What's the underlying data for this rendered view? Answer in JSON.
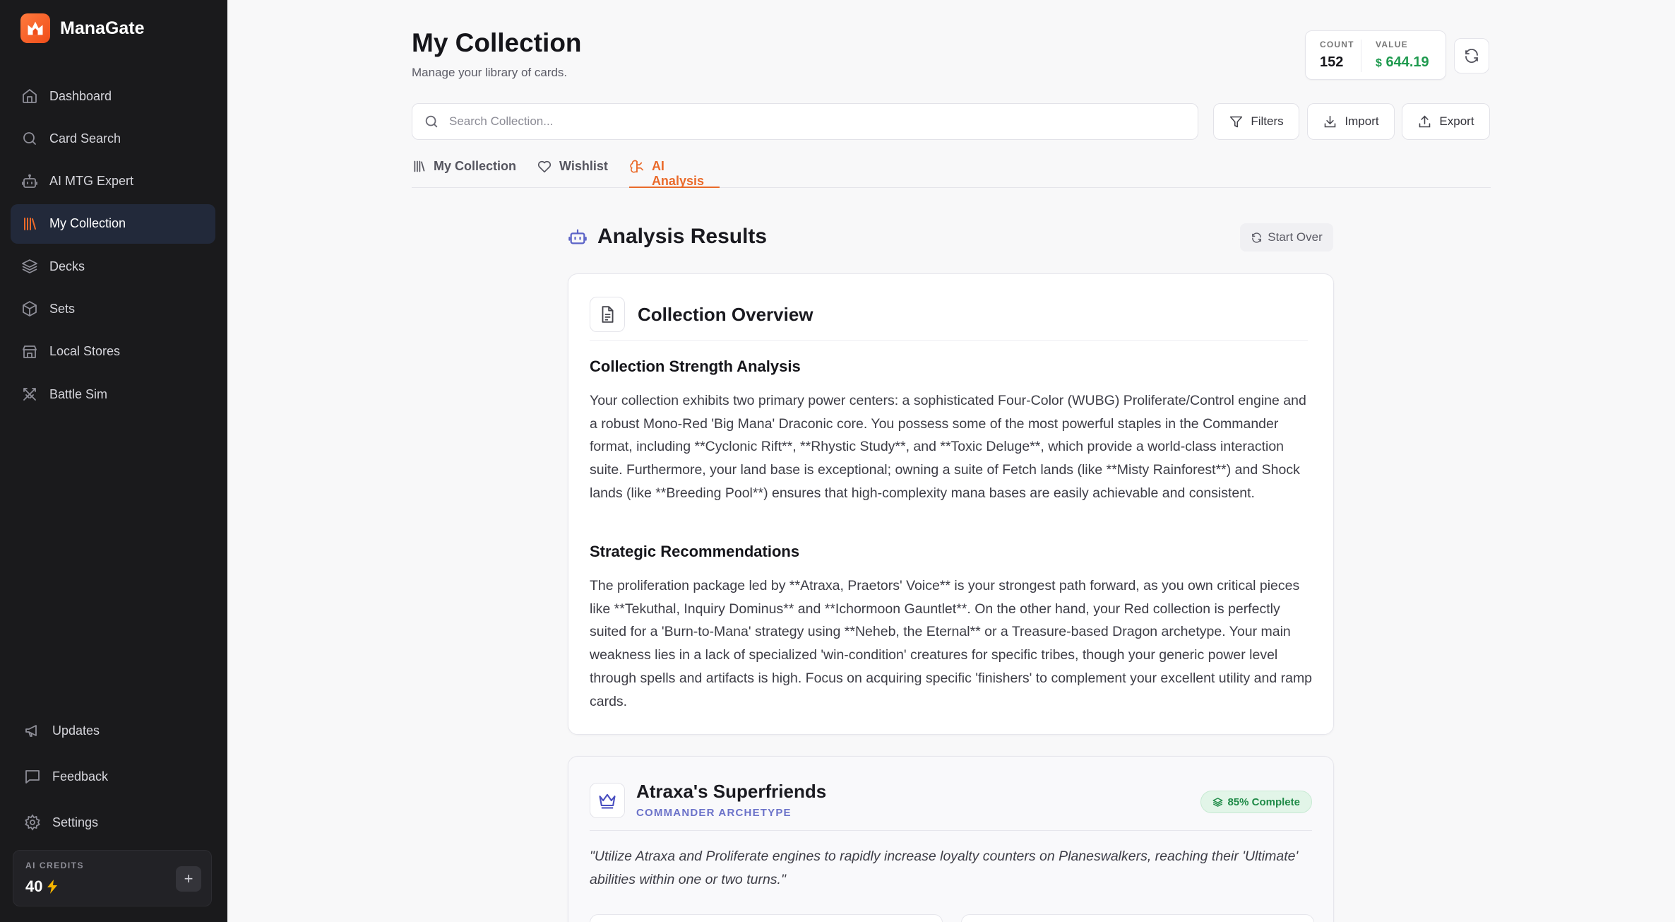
{
  "app": {
    "name": "ManaGate"
  },
  "sidebar": {
    "items": [
      {
        "label": "Dashboard",
        "icon": "home-icon"
      },
      {
        "label": "Card Search",
        "icon": "search-icon"
      },
      {
        "label": "AI MTG Expert",
        "icon": "robot-icon"
      },
      {
        "label": "My Collection",
        "icon": "library-icon",
        "active": true
      },
      {
        "label": "Decks",
        "icon": "layers-icon"
      },
      {
        "label": "Sets",
        "icon": "box-icon"
      },
      {
        "label": "Local Stores",
        "icon": "store-icon"
      },
      {
        "label": "Battle Sim",
        "icon": "swords-icon"
      }
    ],
    "bottom_items": [
      {
        "label": "Updates",
        "icon": "megaphone-icon"
      },
      {
        "label": "Feedback",
        "icon": "message-icon"
      },
      {
        "label": "Settings",
        "icon": "gear-icon"
      }
    ],
    "credits": {
      "label": "AI CREDITS",
      "value": "40",
      "add": "+"
    }
  },
  "header": {
    "title": "My Collection",
    "subtitle": "Manage your library of cards.",
    "stats": {
      "count_label": "COUNT",
      "count_value": "152",
      "value_label": "VALUE",
      "value_currency": "$",
      "value_amount": "644.19"
    }
  },
  "search": {
    "placeholder": "Search Collection..."
  },
  "toolbar": {
    "filters": "Filters",
    "import": "Import",
    "export": "Export"
  },
  "tabs": [
    {
      "label": "My Collection",
      "icon": "library-icon"
    },
    {
      "label": "Wishlist",
      "icon": "heart-icon"
    },
    {
      "label": "AI Analysis",
      "icon": "brain-icon",
      "active": true
    }
  ],
  "analysis": {
    "title": "Analysis Results",
    "start_over": "Start Over",
    "overview": {
      "title": "Collection Overview",
      "sections": [
        {
          "heading": "Collection Strength Analysis",
          "body": "Your collection exhibits two primary power centers: a sophisticated Four-Color (WUBG) Proliferate/Control engine and a robust Mono-Red 'Big Mana' Draconic core. You possess some of the most powerful staples in the Commander format, including **Cyclonic Rift**, **Rhystic Study**, and **Toxic Deluge**, which provide a world-class interaction suite. Furthermore, your land base is exceptional; owning a suite of Fetch lands (like **Misty Rainforest**) and Shock lands (like **Breeding Pool**) ensures that high-complexity mana bases are easily achievable and consistent."
        },
        {
          "heading": "Strategic Recommendations",
          "body": "The proliferation package led by **Atraxa, Praetors' Voice** is your strongest path forward, as you own critical pieces like **Tekuthal, Inquiry Dominus** and **Ichormoon Gauntlet**. On the other hand, your Red collection is perfectly suited for a 'Burn-to-Mana' strategy using **Neheb, the Eternal** or a Treasure-based Dragon archetype. Your main weakness lies in a lack of specialized 'win-condition' creatures for specific tribes, though your generic power level through spells and artifacts is high. Focus on acquiring specific 'finishers' to complement your excellent utility and ramp cards."
        }
      ]
    },
    "archetype": {
      "title": "Atraxa's Superfriends",
      "subtitle": "COMMANDER ARCHETYPE",
      "badge": "85% Complete",
      "quote": "\"Utilize Atraxa and Proliferate engines to rapidly increase loyalty counters on Planeswalkers, reaching their 'Ultimate' abilities within one or two turns.\""
    }
  },
  "colors": {
    "accent": "#ea6a2a",
    "sidebar_bg": "#1a1a1c",
    "value_green": "#1f9a4f",
    "archetype_blue": "#6b72c9"
  }
}
